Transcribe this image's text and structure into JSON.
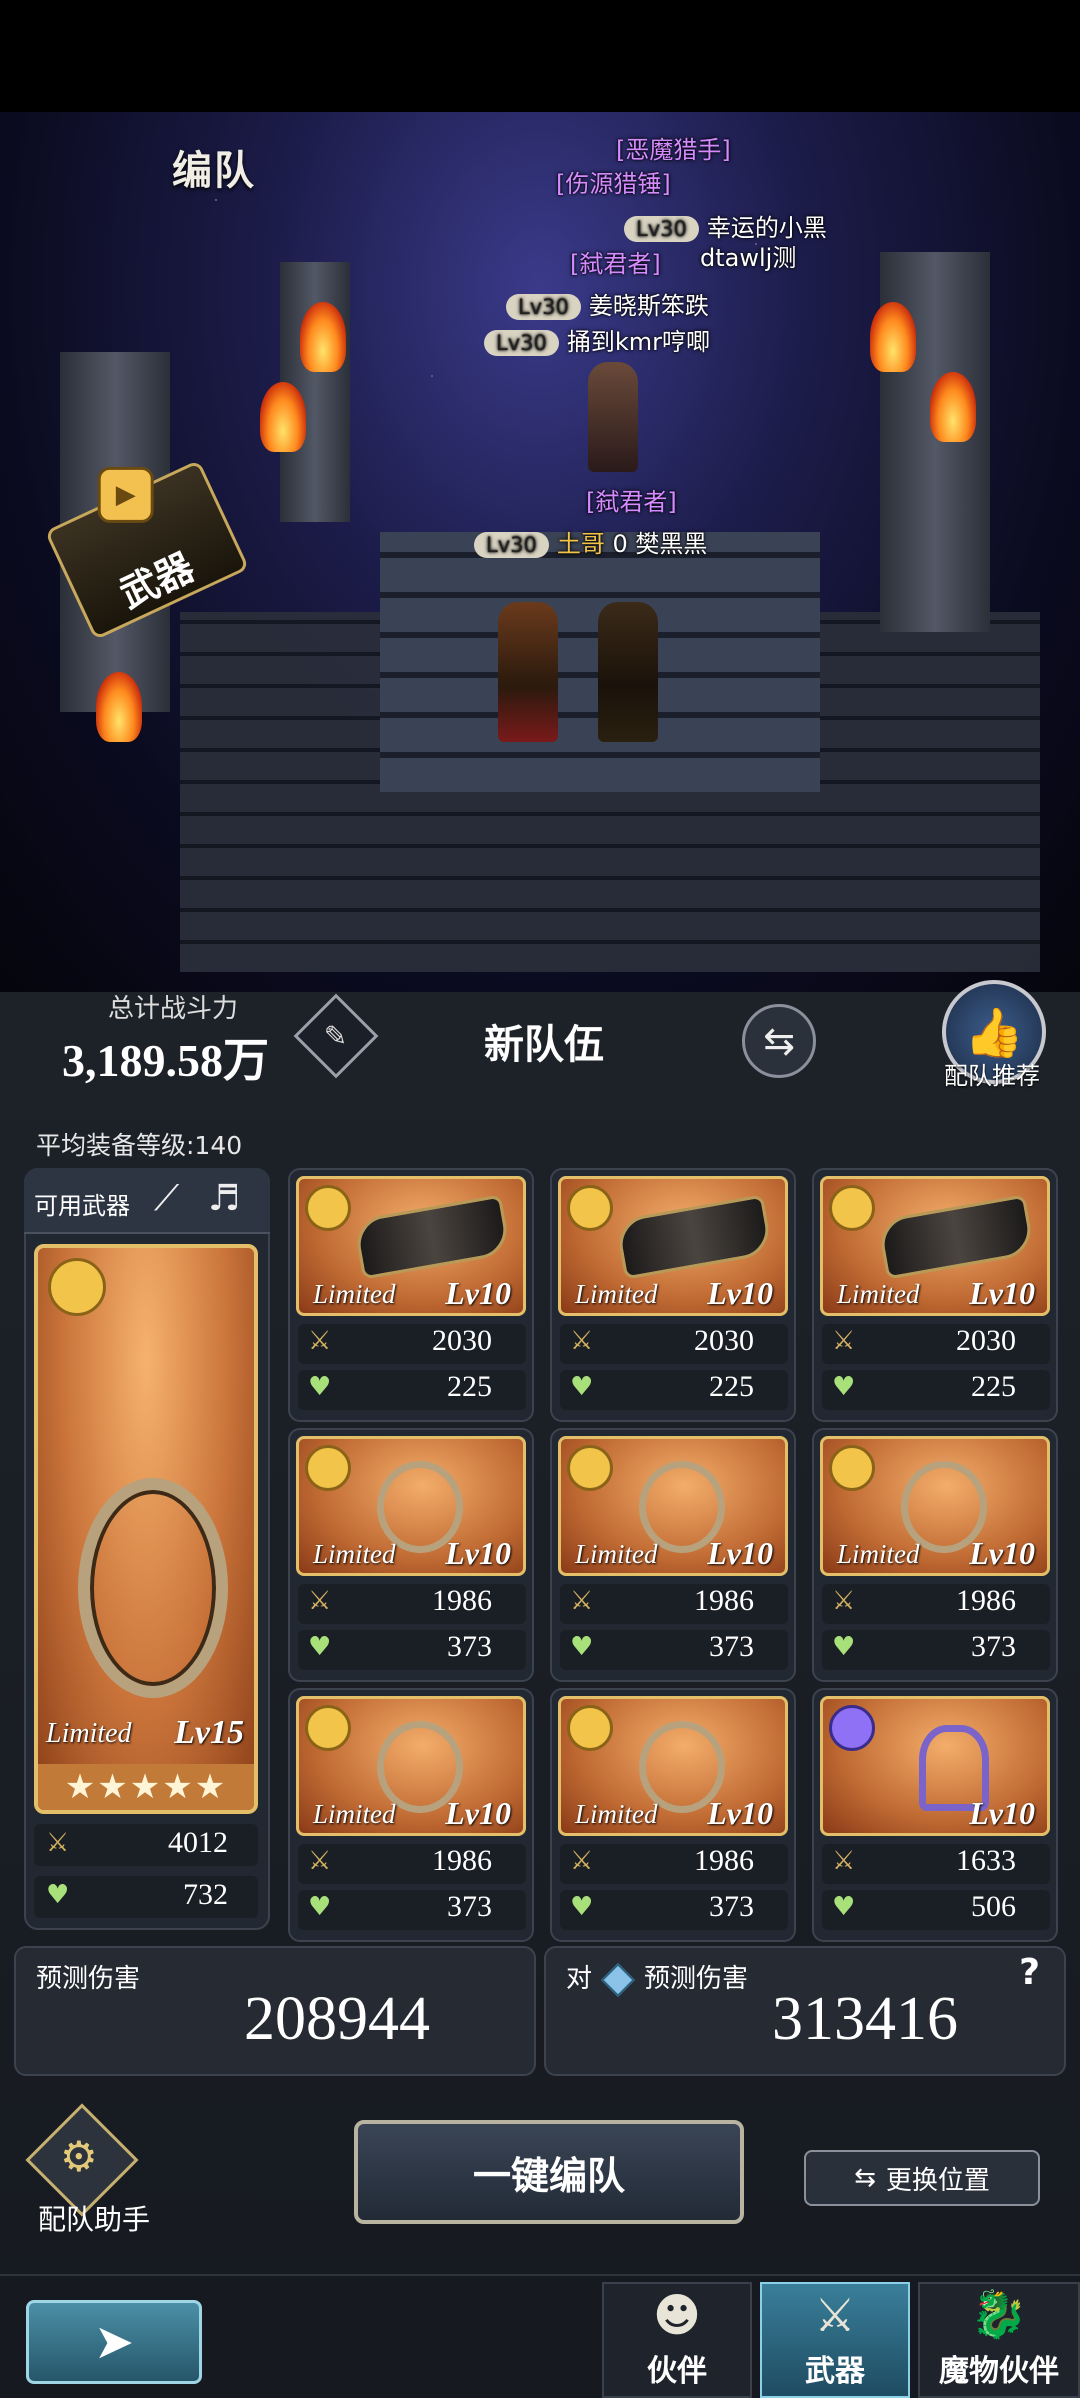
{
  "header": {
    "title": "编队"
  },
  "scene": {
    "weapon_badge": "武器",
    "name_tags": [
      {
        "text": "[恶魔猎手]",
        "color": "purple"
      },
      {
        "text": "[伤源猎锤]",
        "color": "purple"
      },
      {
        "lv": "Lv30",
        "text": "幸运的小黑"
      },
      {
        "text": "[弑君者]",
        "color": "purple"
      },
      {
        "text": "dtawlj测"
      },
      {
        "lv": "Lv30",
        "text": "姜晓斯笨跌"
      },
      {
        "lv": "Lv30",
        "text": "捅到kmr哼唧"
      },
      {
        "text": "[弑君者]",
        "color": "purple"
      },
      {
        "lv": "Lv30",
        "text": "土哥",
        "extra": "0",
        "name": "樊黑黑"
      }
    ]
  },
  "summary": {
    "power_label": "总计战斗力",
    "power_value": "3,189.58万",
    "team_name": "新队伍",
    "recommend_label": "配队推荐",
    "avg_level_label": "平均装备等级:140"
  },
  "available": {
    "title": "可用武器",
    "main": {
      "limited": "Limited",
      "level": "Lv15",
      "stars": "★★★★★",
      "atk": "4012",
      "hp": "732"
    }
  },
  "weapons": [
    {
      "limited": "Limited",
      "level": "Lv10",
      "atk": "2030",
      "hp": "225",
      "kind": "gauntlet"
    },
    {
      "limited": "Limited",
      "level": "Lv10",
      "atk": "2030",
      "hp": "225",
      "kind": "gauntlet"
    },
    {
      "limited": "Limited",
      "level": "Lv10",
      "atk": "2030",
      "hp": "225",
      "kind": "gauntlet"
    },
    {
      "limited": "Limited",
      "level": "Lv10",
      "atk": "1986",
      "hp": "373",
      "kind": "harp"
    },
    {
      "limited": "Limited",
      "level": "Lv10",
      "atk": "1986",
      "hp": "373",
      "kind": "harp"
    },
    {
      "limited": "Limited",
      "level": "Lv10",
      "atk": "1986",
      "hp": "373",
      "kind": "harp"
    },
    {
      "limited": "Limited",
      "level": "Lv10",
      "atk": "1986",
      "hp": "373",
      "kind": "harp"
    },
    {
      "limited": "Limited",
      "level": "Lv10",
      "atk": "1986",
      "hp": "373",
      "kind": "harp"
    },
    {
      "limited": "",
      "level": "Lv10",
      "atk": "1633",
      "hp": "506",
      "kind": "lyre"
    }
  ],
  "damage": {
    "predict_label": "预测伤害",
    "predict_value": "208944",
    "vs_prefix": "对",
    "vs_label": "预测伤害",
    "vs_value": "313416",
    "help": "?"
  },
  "actions": {
    "assist_label": "配队助手",
    "auto_button": "一键编队",
    "swap_position": "更换位置"
  },
  "tabs": [
    {
      "label": "伙伴"
    },
    {
      "label": "武器"
    },
    {
      "label": "魔物伙伴"
    }
  ],
  "colors": {
    "gold_frame": "#e3bf69",
    "active_tab": "#3a7f9a"
  }
}
